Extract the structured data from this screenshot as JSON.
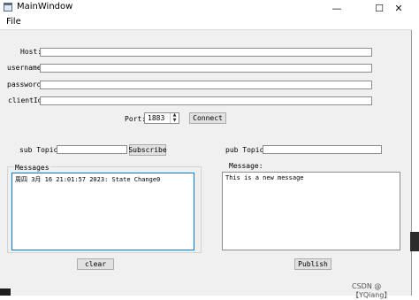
{
  "window": {
    "title": "MainWindow",
    "minimize_glyph": "—",
    "maximize_glyph": "☐",
    "close_glyph": "✕"
  },
  "menu": {
    "file": "File"
  },
  "connection": {
    "host_label": "Host:",
    "username_label": "username:",
    "password_label": "password:",
    "clientid_label": "clientId:",
    "host_value": "",
    "username_value": "",
    "password_value": "",
    "clientid_value": "",
    "port_label": "Port:",
    "port_value": "1883",
    "connect_button": "Connect"
  },
  "subscribe": {
    "topic_label": "sub Topic:",
    "topic_value": "",
    "subscribe_button": "Subscribe",
    "messages_label": "Messages",
    "messages_text": "周四 3月 16 21:01:57 2023: State Change0",
    "clear_button": "clear"
  },
  "publish": {
    "topic_label": "pub Topic:",
    "topic_value": "",
    "message_label": "Message:",
    "message_text": "This is a new message",
    "publish_button": "Publish"
  },
  "watermark": "CSDN @ 【YQiang】"
}
